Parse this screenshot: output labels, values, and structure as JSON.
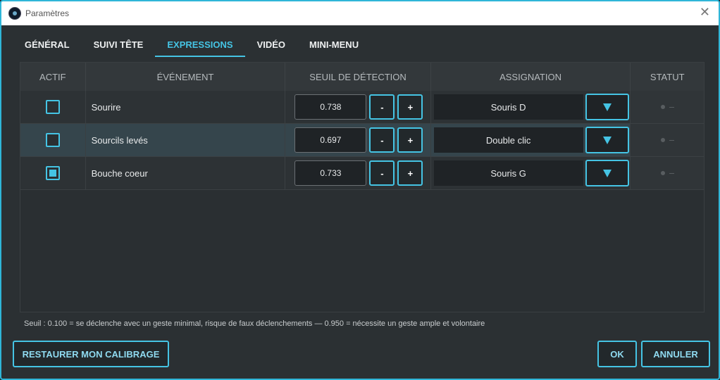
{
  "window": {
    "title": "Paramètres",
    "close_glyph": "✕",
    "app_icon": "app-logo-icon"
  },
  "tabs": [
    {
      "label": "GÉNÉRAL",
      "active": false
    },
    {
      "label": "SUIVI TÊTE",
      "active": false
    },
    {
      "label": "EXPRESSIONS",
      "active": true
    },
    {
      "label": "VIDÉO",
      "active": false
    },
    {
      "label": "MINI-MENU",
      "active": false
    }
  ],
  "table": {
    "headers": [
      "ACTIF",
      "ÉVÉNEMENT",
      "SEUIL DE DÉTECTION",
      "ASSIGNATION",
      "STATUT"
    ],
    "rows": [
      {
        "active": false,
        "event": "Sourire",
        "threshold": "0.738",
        "assignment": "Souris D"
      },
      {
        "active": false,
        "event": "Sourcils levés",
        "threshold": "0.697",
        "assignment": "Double clic"
      },
      {
        "active": true,
        "event": "Bouche coeur",
        "threshold": "0.733",
        "assignment": "Souris G"
      }
    ],
    "minus_label": "-",
    "plus_label": "+"
  },
  "hint": "Seuil : 0.100 = se déclenche avec un geste minimal, risque de faux déclenchements — 0.950 = nécessite un geste ample et volontaire",
  "buttons": {
    "restore": "RESTAURER MON CALIBRAGE",
    "ok": "OK",
    "cancel": "ANNULER"
  },
  "colors": {
    "accent": "#45c4e4",
    "background": "#2b3033",
    "header_bg": "#33383b",
    "highlight_row": "#35454c"
  }
}
